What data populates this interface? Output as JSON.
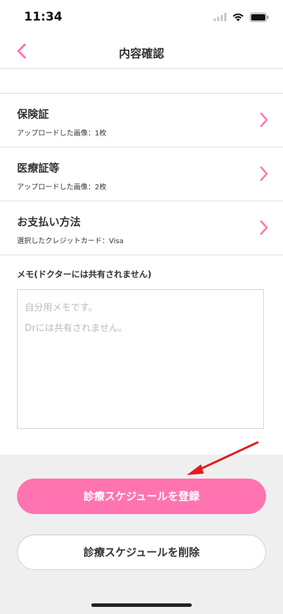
{
  "status": {
    "time": "11:34"
  },
  "nav": {
    "title": "内容確認"
  },
  "rows": [
    {
      "title": "保険証",
      "subtitle": "アップロードした画像：1枚"
    },
    {
      "title": "医療証等",
      "subtitle": "アップロードした画像：2枚"
    },
    {
      "title": "お支払い方法",
      "subtitle": "選択したクレジットカード：Visa"
    }
  ],
  "memo": {
    "label": "メモ(ドクターには共有されません)",
    "placeholder_line1": "自分用メモです。",
    "placeholder_line2": "Drには共有されません。"
  },
  "buttons": {
    "register": "診療スケジュールを登録",
    "delete": "診療スケジュールを削除"
  },
  "colors": {
    "accent": "#ff74b0",
    "annotation_arrow": "#e01b1b"
  }
}
